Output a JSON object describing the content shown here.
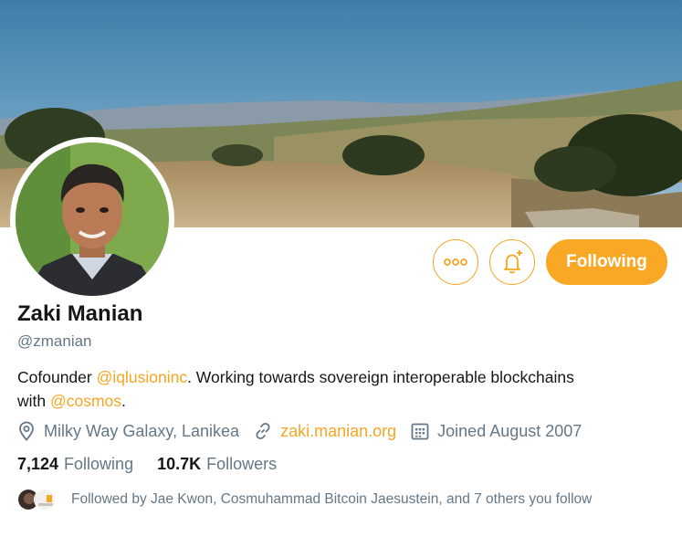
{
  "profile": {
    "name": "Zaki Manian",
    "handle": "@zmanian",
    "bio": {
      "part1": "Cofounder ",
      "mention1": "@iqlusioninc",
      "part2": ". Working towards sovereign interoperable blockchains with ",
      "mention2": "@cosmos",
      "part3": "."
    },
    "location": "Milky Way Galaxy, Lanikea",
    "website": "zaki.manian.org",
    "joined": "Joined August 2007"
  },
  "actions": {
    "more_icon": "more-options-icon",
    "notify_icon": "bell-plus-icon",
    "follow_label": "Following"
  },
  "stats": {
    "following_count": "7,124",
    "following_label": "Following",
    "followers_count": "10.7K",
    "followers_label": "Followers"
  },
  "followed_by": "Followed by Jae Kwon, Cosmuhammad Bitcoin Jaesustein, and 7 others you follow",
  "colors": {
    "accent": "#f5a623",
    "follow_button": "#f9a825",
    "secondary_text": "#657786",
    "primary_text": "#14171a"
  }
}
